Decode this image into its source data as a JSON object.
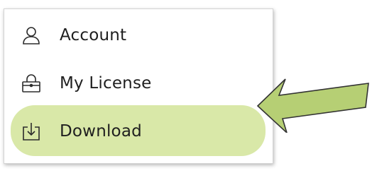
{
  "menu": {
    "items": [
      {
        "label": "Account",
        "icon": "person-icon"
      },
      {
        "label": "My License",
        "icon": "license-lock-icon"
      },
      {
        "label": "Download",
        "icon": "download-icon"
      }
    ]
  },
  "annotation": {
    "highlight_color": "#d9e8a8",
    "arrow_color": "#b6cf74",
    "highlighted_item": "Download"
  }
}
